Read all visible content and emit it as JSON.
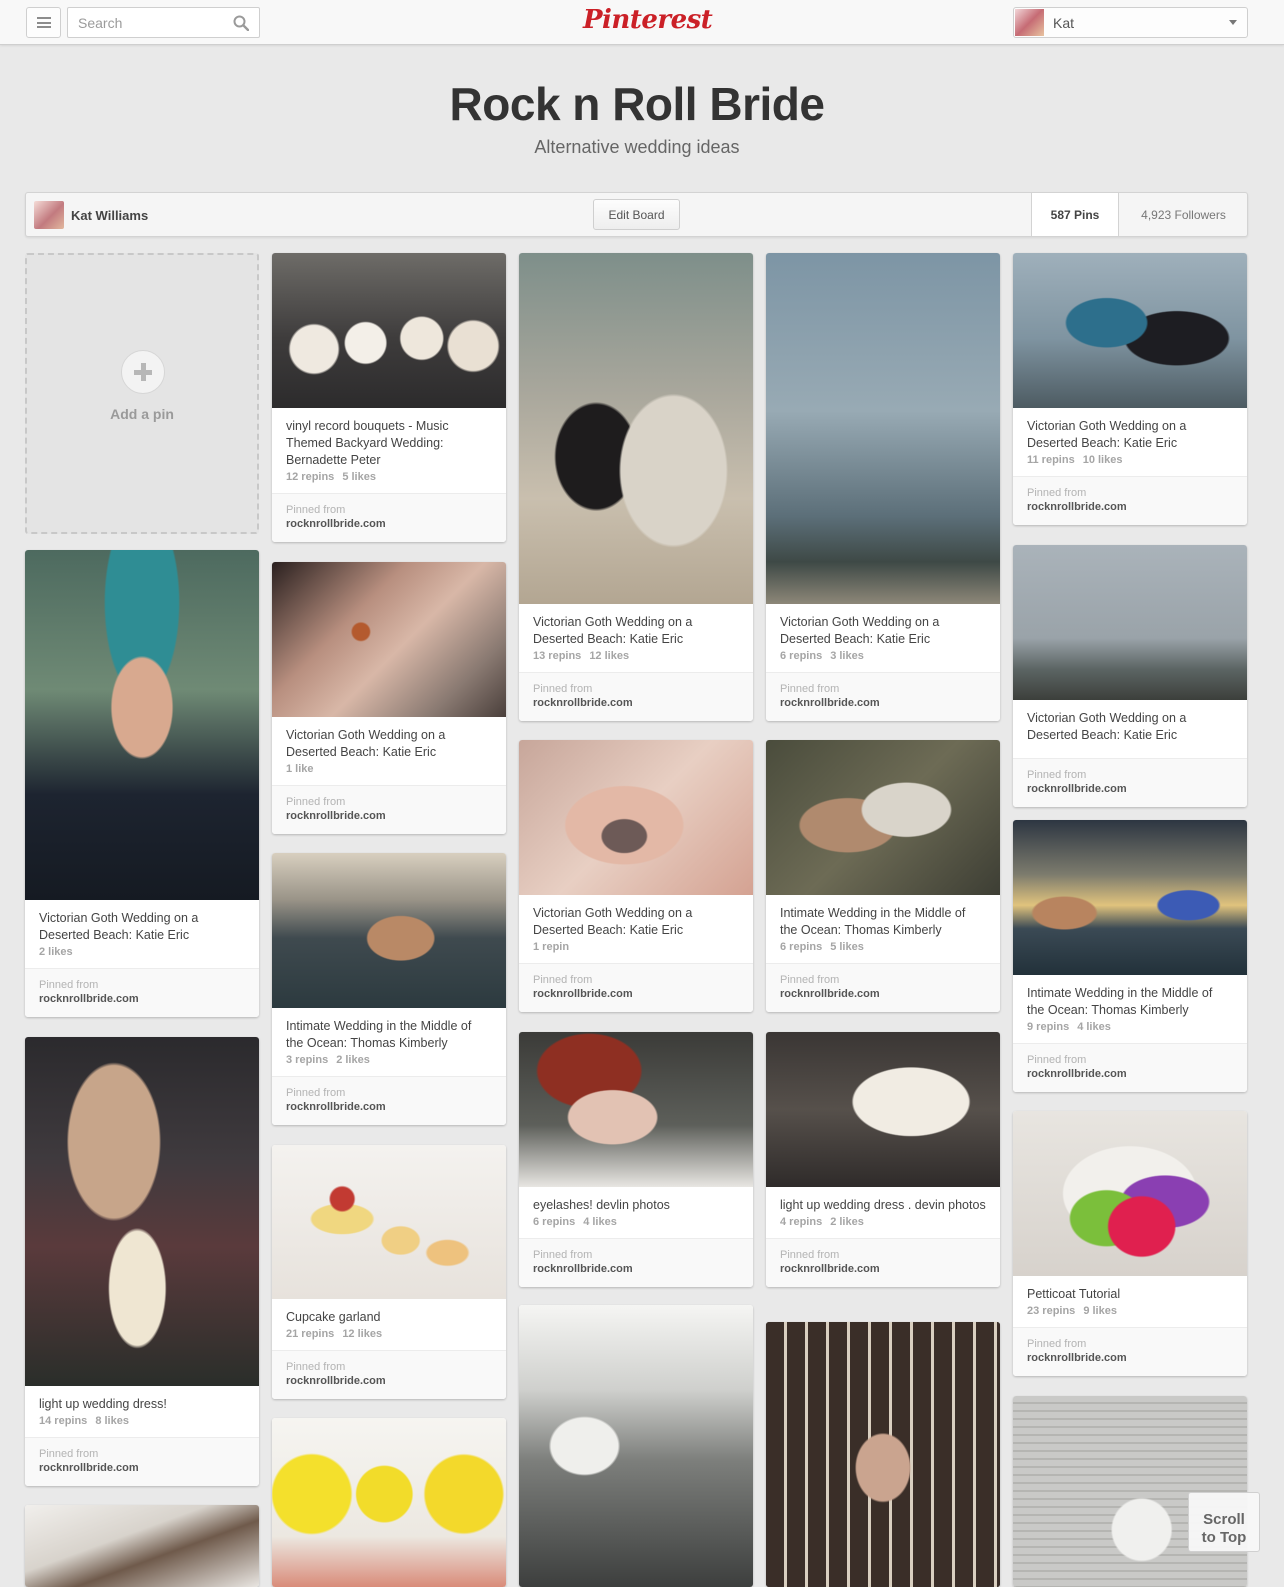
{
  "header": {
    "search_placeholder": "Search",
    "logo_text": "Pinterest",
    "user_name": "Kat",
    "brand_color": "#cb2027"
  },
  "board": {
    "title": "Rock n Roll Bride",
    "description": "Alternative wedding ideas",
    "owner": "Kat Williams",
    "edit_label": "Edit Board",
    "pins_count": "587 Pins",
    "followers_count": "4,923 Followers"
  },
  "add_pin_label": "Add a pin",
  "scroll_top_label_1": "Scroll",
  "scroll_top_label_2": "to Top",
  "pinned_from_label": "Pinned from",
  "pins": [
    {
      "desc": "vinyl record bouquets - Music Themed Backyard Wedding: Bernadette Peter",
      "repins": "12 repins",
      "likes": "5 likes",
      "domain": "rocknrollbride.com",
      "image": "bouquets-photo"
    },
    {
      "desc": "Victorian Goth Wedding on a Deserted Beach: Katie Eric",
      "repins": "13 repins",
      "likes": "12 likes",
      "domain": "rocknrollbride.com",
      "image": "couple-walking-photo"
    },
    {
      "desc": "Victorian Goth Wedding on a Deserted Beach: Katie Eric",
      "repins": "6 repins",
      "likes": "3 likes",
      "domain": "rocknrollbride.com",
      "image": "dead-tree-beach-photo"
    },
    {
      "desc": "Victorian Goth Wedding on a Deserted Beach: Katie Eric",
      "repins": "11 repins",
      "likes": "10 likes",
      "domain": "rocknrollbride.com",
      "image": "goth-couple-kiss-photo"
    },
    {
      "desc": "Victorian Goth Wedding on a Deserted Beach: Katie Eric",
      "repins": "",
      "likes": "2 likes",
      "domain": "rocknrollbride.com",
      "image": "blue-mohawk-groom-photo"
    },
    {
      "desc": "Victorian Goth Wedding on a Deserted Beach: Katie Eric",
      "repins": "",
      "likes": "1 like",
      "domain": "rocknrollbride.com",
      "image": "necklace-closeup-photo"
    },
    {
      "desc": "Victorian Goth Wedding on a Deserted Beach: Katie Eric",
      "repins": "",
      "likes": "",
      "domain": "rocknrollbride.com",
      "image": "tree-shore-photo"
    },
    {
      "desc": "Victorian Goth Wedding on a Deserted Beach: Katie Eric",
      "repins": "1 repin",
      "likes": "",
      "domain": "rocknrollbride.com",
      "image": "butterfly-tattoo-photo"
    },
    {
      "desc": "Intimate Wedding in the Middle of the Ocean: Thomas Kimberly",
      "repins": "6 repins",
      "likes": "5 likes",
      "domain": "rocknrollbride.com",
      "image": "couple-lying-photo"
    },
    {
      "desc": "Intimate Wedding in the Middle of the Ocean: Thomas Kimberly",
      "repins": "9 repins",
      "likes": "4 likes",
      "domain": "rocknrollbride.com",
      "image": "champagne-sea-photo"
    },
    {
      "desc": "Intimate Wedding in the Middle of the Ocean: Thomas Kimberly",
      "repins": "3 repins",
      "likes": "2 likes",
      "domain": "rocknrollbride.com",
      "image": "ocean-kiss-photo"
    },
    {
      "desc": "light up wedding dress!",
      "repins": "14 repins",
      "likes": "8 likes",
      "domain": "rocknrollbride.com",
      "image": "fairy-lights-couple-photo"
    },
    {
      "desc": "eyelashes! devlin photos",
      "repins": "6 repins",
      "likes": "4 likes",
      "domain": "rocknrollbride.com",
      "image": "red-hair-bride-photo"
    },
    {
      "desc": "light up wedding dress . devin photos",
      "repins": "4 repins",
      "likes": "2 likes",
      "domain": "rocknrollbride.com",
      "image": "white-dress-photo"
    },
    {
      "desc": "Cupcake garland",
      "repins": "21 repins",
      "likes": "12 likes",
      "domain": "rocknrollbride.com",
      "image": "cupcake-garland-photo"
    },
    {
      "desc": "Petticoat Tutorial",
      "repins": "23 repins",
      "likes": "9 likes",
      "domain": "rocknrollbride.com",
      "image": "petticoat-photo"
    }
  ]
}
